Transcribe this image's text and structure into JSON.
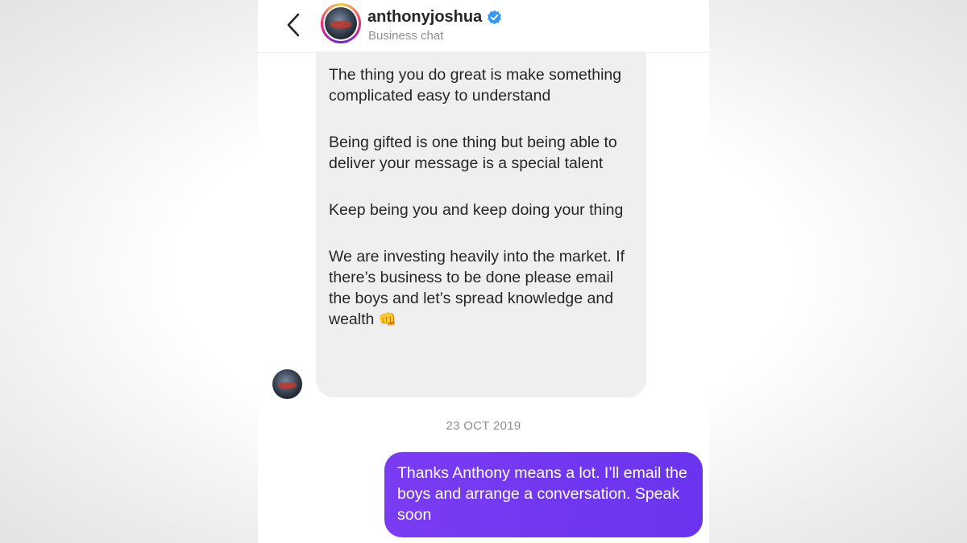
{
  "header": {
    "username": "anthonyjoshua",
    "subtitle": "Business chat",
    "icons": {
      "back": "chevron-left-icon",
      "verified": "verified-badge-icon"
    }
  },
  "messages": {
    "incoming": {
      "paragraphs": [
        "The thing you do great is make something complicated easy to understand",
        "Being gifted is one thing but being able to deliver your message is a special talent",
        "Keep being you and keep doing your thing",
        "We are investing heavily into the market. If there’s business to be done please email the boys and let’s spread knowledge and wealth"
      ],
      "emoji": "👊"
    },
    "date_separator": "23 OCT 2019",
    "outgoing": {
      "text": "Thanks Anthony means a lot. I’ll email the boys and arrange a conversation. Speak soon"
    }
  },
  "colors": {
    "accent_verified": "#3897f0",
    "outgoing_bubble": "#6a34ee",
    "incoming_bubble": "#efefef",
    "secondary_text": "#8e8e8e"
  }
}
